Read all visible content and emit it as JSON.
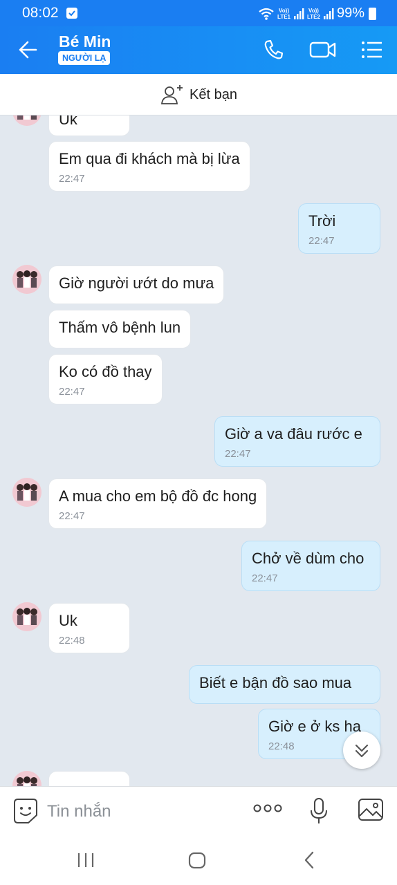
{
  "status_bar": {
    "time": "08:02",
    "lte1": "Vo))\nLTE1",
    "lte2": "Vo))\nLTE2",
    "battery": "99%"
  },
  "header": {
    "contact_name": "Bé Min",
    "badge": "NGƯỜI LẠ"
  },
  "friend_bar": {
    "label": "Kết bạn"
  },
  "messages": [
    {
      "side": "in",
      "text": "Uk",
      "time": ""
    },
    {
      "side": "in",
      "text": "Em qua đi khách mà bị lừa",
      "time": "22:47"
    },
    {
      "side": "out",
      "text": "Trời",
      "time": "22:47"
    },
    {
      "side": "in",
      "text": "Giờ người ướt do mưa",
      "time": ""
    },
    {
      "side": "in",
      "text": "Thấm vô bệnh lun",
      "time": ""
    },
    {
      "side": "in",
      "text": "Ko có đồ thay",
      "time": "22:47"
    },
    {
      "side": "out",
      "text": "Giờ a va  đâu rước e",
      "time": "22:47"
    },
    {
      "side": "in",
      "text": "A mua cho em bộ đồ đc hong",
      "time": "22:47"
    },
    {
      "side": "out",
      "text": "Chở về dùm cho",
      "time": "22:47"
    },
    {
      "side": "in",
      "text": "Uk",
      "time": "22:48"
    },
    {
      "side": "out",
      "text": "Biết e bận  đồ sao  mua",
      "time": ""
    },
    {
      "side": "out",
      "text": "Giờ  e ở  ks ha",
      "time": "22:48"
    },
    {
      "side": "in",
      "text": "",
      "time": ""
    }
  ],
  "input": {
    "placeholder": "Tin nhắn"
  },
  "colors": {
    "header_blue": "#1a7ef2",
    "outgoing_bubble": "#d7effd",
    "incoming_bubble": "#ffffff",
    "chat_bg": "#e2e8ef"
  }
}
